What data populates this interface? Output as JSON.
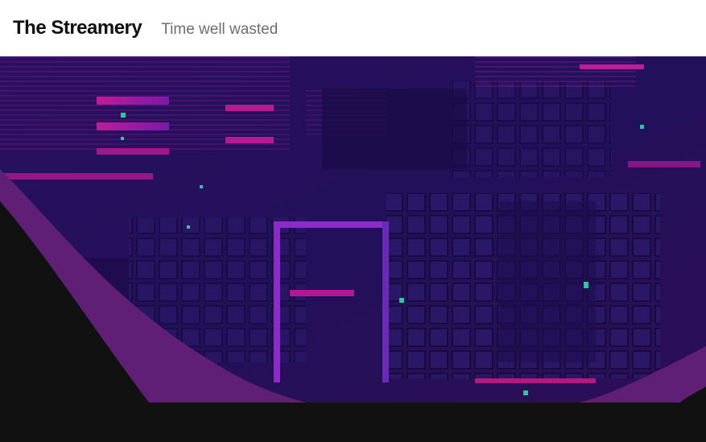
{
  "header": {
    "site_title": "The Streamery",
    "tagline": "Time well wasted"
  },
  "hero": {
    "image_name": "circuit-board-hero-image",
    "colors": {
      "base": "#24105a",
      "magenta": "#b0178f",
      "violet": "#5a2bb8",
      "teal": "#2fc7a0",
      "curve_dark": "#111111",
      "curve_band": "#5e1f74"
    }
  },
  "footer": {
    "background": "#111111"
  }
}
